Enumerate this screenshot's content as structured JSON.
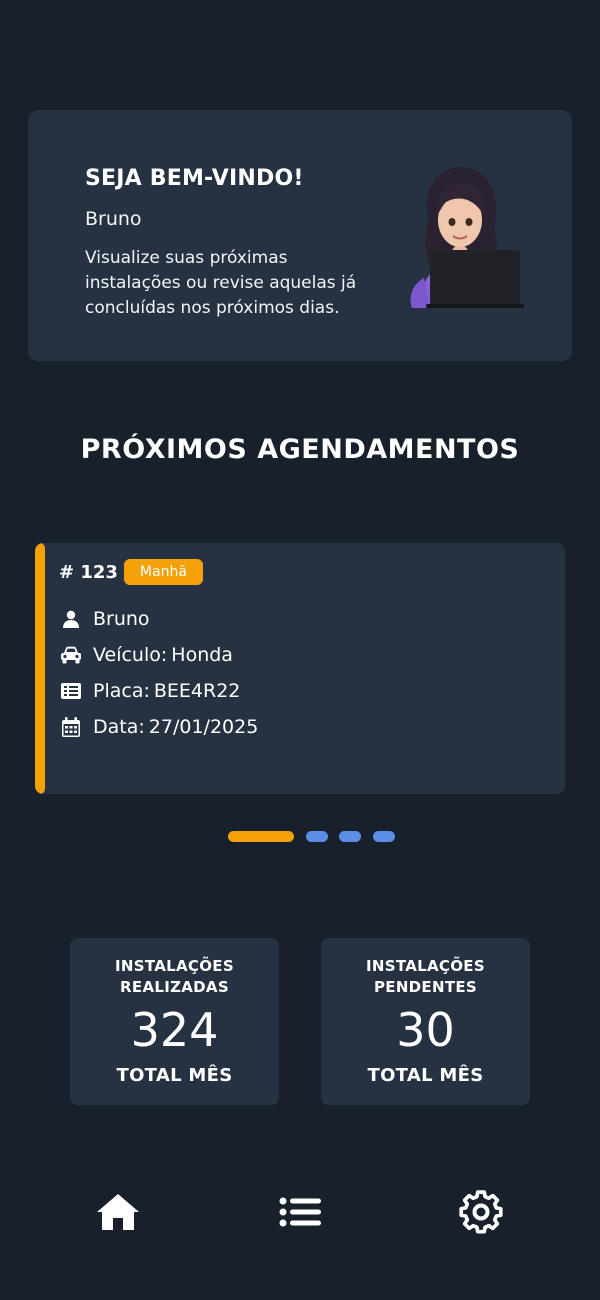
{
  "welcome": {
    "title": "SEJA BEM-VINDO!",
    "user_name": "Bruno",
    "description": "Visualize suas próximas instalações ou revise aquelas já concluídas nos próximos dias."
  },
  "section_title": "PRÓXIMOS AGENDAMENTOS",
  "appointment": {
    "id": "# 123",
    "period": "Manhã",
    "client": "Bruno",
    "vehicle_label": "Veículo:",
    "vehicle": "Honda",
    "plate_label": "Placa:",
    "plate": "BEE4R22",
    "date_label": "Data:",
    "date": "27/01/2025"
  },
  "pager": {
    "total": 4,
    "active_index": 0
  },
  "stats": [
    {
      "label_line1": "INSTALAÇÕES",
      "label_line2": "REALIZADAS",
      "value": "324",
      "footer": "TOTAL MÊS"
    },
    {
      "label_line1": "INSTALAÇÕES",
      "label_line2": "PENDENTES",
      "value": "30",
      "footer": "TOTAL MÊS"
    }
  ],
  "nav": [
    {
      "icon": "home-icon"
    },
    {
      "icon": "list-icon"
    },
    {
      "icon": "gear-icon"
    }
  ],
  "colors": {
    "background": "#18202b",
    "card": "#263241",
    "accent": "#f5a20a",
    "pager_inactive": "#5b8ee6"
  }
}
